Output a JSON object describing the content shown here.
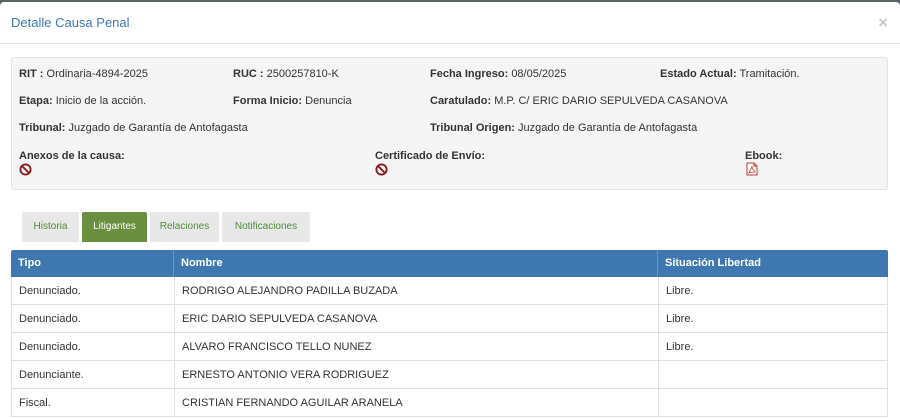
{
  "modal": {
    "title": "Detalle Causa Penal",
    "close_label": "×"
  },
  "info": {
    "rit_label": "RIT :",
    "rit_value": "Ordinaria-4894-2025",
    "ruc_label": "RUC :",
    "ruc_value": "2500257810-K",
    "fecha_label": "Fecha Ingreso:",
    "fecha_value": "08/05/2025",
    "estado_label": "Estado Actual:",
    "estado_value": "Tramitación.",
    "etapa_label": "Etapa:",
    "etapa_value": "Inicio de la acción.",
    "forma_label": "Forma Inicio:",
    "forma_value": "Denuncia",
    "caratulado_label": "Caratulado:",
    "caratulado_value": "M.P. C/ ERIC DARIO SEPULVEDA CASANOVA",
    "tribunal_label": "Tribunal:",
    "tribunal_value": "Juzgado de Garantía de Antofagasta",
    "tribunal_origen_label": "Tribunal Origen:",
    "tribunal_origen_value": "Juzgado de Garantía de Antofagasta",
    "anexos_label": "Anexos de la causa:",
    "certificado_label": "Certificado de Envío:",
    "ebook_label": "Ebook:",
    "ban_icon_color": "#8b1a1a",
    "pdf_icon_color": "#c0392b"
  },
  "tabs": [
    {
      "label": "Historia",
      "active": false
    },
    {
      "label": "Litigantes",
      "active": true
    },
    {
      "label": "Relaciones",
      "active": false
    },
    {
      "label": "Notificaciones",
      "active": false
    }
  ],
  "table": {
    "headers": [
      "Tipo",
      "Nombre",
      "Situación Libertad"
    ],
    "rows": [
      [
        "Denunciado.",
        "RODRIGO ALEJANDRO PADILLA BUZADA",
        "Libre."
      ],
      [
        "Denunciado.",
        "ERIC DARIO SEPULVEDA CASANOVA",
        "Libre."
      ],
      [
        "Denunciado.",
        "ALVARO FRANCISCO TELLO NUNEZ",
        "Libre."
      ],
      [
        "Denunciante.",
        "ERNESTO ANTONIO VERA RODRIGUEZ",
        ""
      ],
      [
        "Fiscal.",
        "CRISTIAN FERNANDO AGUILAR ARANELA",
        ""
      ]
    ]
  },
  "colors": {
    "header_blue": "#3f78b0",
    "tab_active": "#6a8f3f",
    "tab_text": "#4f8a3a"
  }
}
